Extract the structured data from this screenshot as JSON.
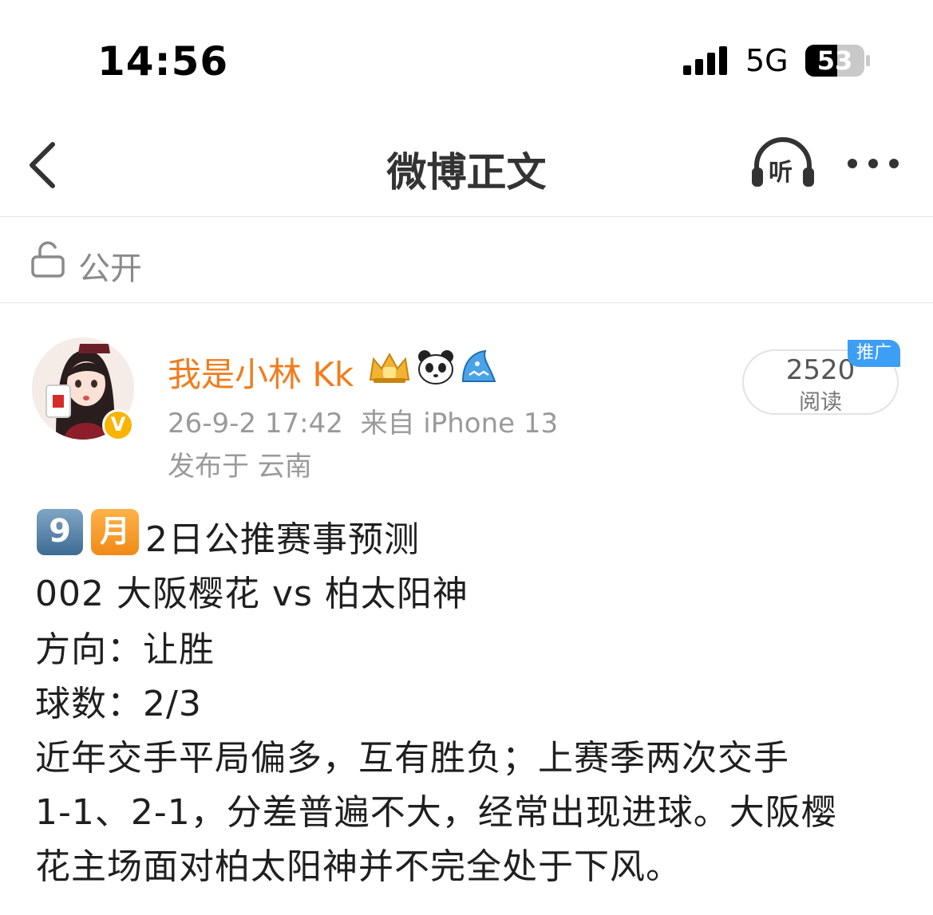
{
  "status_bar": {
    "time": "14:56",
    "network": "5G",
    "battery": "53"
  },
  "nav": {
    "title": "微博正文",
    "listen_label": "听",
    "back_icon": "chevron-left-icon",
    "more_icon": "more-dots-icon"
  },
  "visibility": {
    "label": "公开",
    "icon": "lock-open-icon"
  },
  "post": {
    "username": "我是小林 Kk",
    "verified_mark": "V",
    "meta": "26-9-2 17:42  来自 iPhone 13",
    "location": "发布于 云南",
    "read_count": "2520",
    "read_label": "阅读",
    "promo_tag": "推广",
    "emoji_nine": "9",
    "emoji_month": "月",
    "title_line": "2日公推赛事预测",
    "match_line": "002 大阪樱花 vs 柏太阳神",
    "direction_line": "方向：让胜",
    "goals_line": "球数：2/3",
    "analysis_lines": [
      "近年交手平局偏多，互有胜负；上赛季两次交手",
      "1-1、2-1，分差普遍不大，经常出现进球。大阪樱",
      "花主场面对柏太阳神并不完全处于下风。"
    ]
  },
  "colors": {
    "username": "#f27c1c",
    "promo": "#3d9ef5",
    "verified": "#f8b400"
  }
}
